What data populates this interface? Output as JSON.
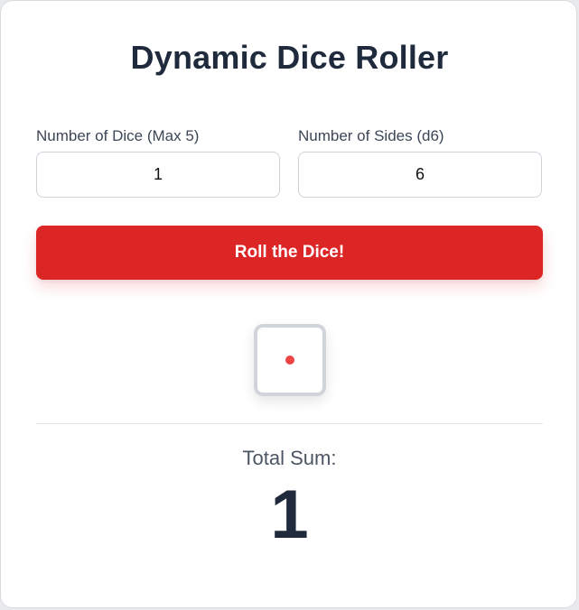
{
  "app": {
    "title": "Dynamic Dice Roller"
  },
  "controls": {
    "dice_count_label": "Number of Dice (Max 5)",
    "dice_count_value": "1",
    "sides_label": "Number of Sides (d6)",
    "sides_value": "6",
    "roll_button_label": "Roll the Dice!"
  },
  "dice": [
    {
      "value": 1,
      "pip_color": "#ef4444"
    }
  ],
  "result": {
    "total_label": "Total Sum:",
    "total_value": "1"
  },
  "colors": {
    "accent": "#dc2626",
    "text_dark": "#1f2a3c",
    "pip": "#ef4444"
  }
}
